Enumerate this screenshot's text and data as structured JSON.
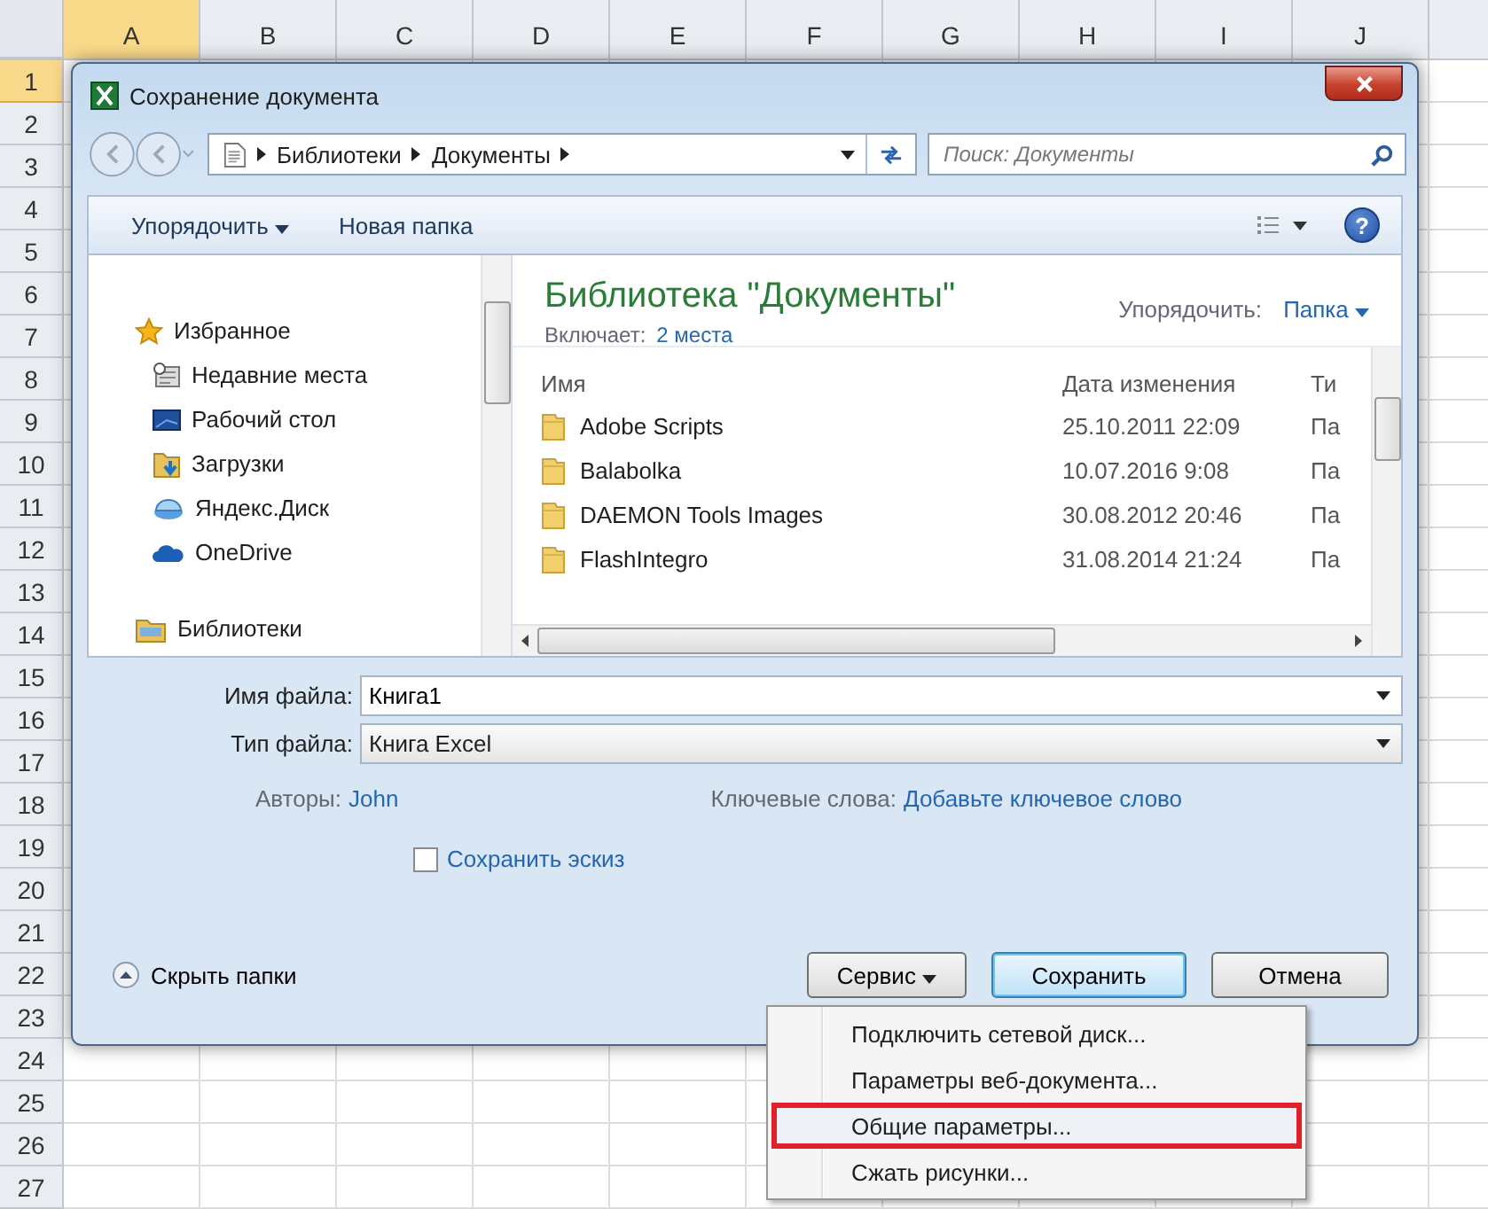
{
  "spreadsheet": {
    "columns": [
      {
        "label": "A",
        "selected": true
      },
      {
        "label": "B",
        "selected": false
      },
      {
        "label": "C",
        "selected": false
      },
      {
        "label": "D",
        "selected": false
      },
      {
        "label": "E",
        "selected": false
      },
      {
        "label": "F",
        "selected": false
      },
      {
        "label": "G",
        "selected": false
      },
      {
        "label": "H",
        "selected": false
      },
      {
        "label": "I",
        "selected": false
      },
      {
        "label": "J",
        "selected": false
      }
    ],
    "rows": [
      {
        "label": "1",
        "selected": true
      },
      {
        "label": "2",
        "selected": false
      },
      {
        "label": "3",
        "selected": false
      },
      {
        "label": "4",
        "selected": false
      },
      {
        "label": "5",
        "selected": false
      },
      {
        "label": "6",
        "selected": false
      },
      {
        "label": "7",
        "selected": false
      },
      {
        "label": "8",
        "selected": false
      },
      {
        "label": "9",
        "selected": false
      },
      {
        "label": "10",
        "selected": false
      },
      {
        "label": "11",
        "selected": false
      },
      {
        "label": "12",
        "selected": false
      },
      {
        "label": "13",
        "selected": false
      },
      {
        "label": "14",
        "selected": false
      },
      {
        "label": "15",
        "selected": false
      },
      {
        "label": "16",
        "selected": false
      },
      {
        "label": "17",
        "selected": false
      },
      {
        "label": "18",
        "selected": false
      },
      {
        "label": "19",
        "selected": false
      },
      {
        "label": "20",
        "selected": false
      },
      {
        "label": "21",
        "selected": false
      },
      {
        "label": "22",
        "selected": false
      },
      {
        "label": "23",
        "selected": false
      },
      {
        "label": "24",
        "selected": false
      },
      {
        "label": "25",
        "selected": false
      },
      {
        "label": "26",
        "selected": false
      },
      {
        "label": "27",
        "selected": false
      }
    ]
  },
  "dialog": {
    "title": "Сохранение документа",
    "breadcrumb": [
      "Библиотеки",
      "Документы"
    ],
    "search": {
      "placeholder": "Поиск: Документы"
    },
    "organize_button": "Упорядочить",
    "new_folder_button": "Новая папка",
    "help_button": "?",
    "nav": [
      {
        "label": "Избранное",
        "kind": "favorites",
        "children": [
          {
            "label": "Недавние места",
            "kind": "recent"
          },
          {
            "label": "Рабочий стол",
            "kind": "desktop"
          },
          {
            "label": "Загрузки",
            "kind": "downloads"
          },
          {
            "label": "Яндекс.Диск",
            "kind": "yadisk"
          },
          {
            "label": "OneDrive",
            "kind": "onedrive"
          }
        ]
      },
      {
        "label": "Библиотеки",
        "kind": "libraries"
      }
    ],
    "library": {
      "title": "Библиотека \"Документы\"",
      "includes_label": "Включает:",
      "includes_link": "2 места",
      "arrange_label": "Упорядочить:",
      "arrange_value": "Папка"
    },
    "columns": [
      "Имя",
      "Дата изменения",
      "Ти"
    ],
    "files": [
      {
        "name": "Adobe Scripts",
        "date": "25.10.2011 22:09",
        "type": "Па"
      },
      {
        "name": "Balabolka",
        "date": "10.07.2016 9:08",
        "type": "Па"
      },
      {
        "name": "DAEMON Tools Images",
        "date": "30.08.2012 20:46",
        "type": "Па"
      },
      {
        "name": "FlashIntegro",
        "date": "31.08.2014 21:24",
        "type": "Па"
      }
    ],
    "form": {
      "file_name_label": "Имя файла:",
      "file_name": "Книга1",
      "file_type_label": "Тип файла:",
      "file_type": "Книга Excel",
      "authors_label": "Авторы:",
      "authors": "John",
      "keywords_label": "Ключевые слова:",
      "keywords": "Добавьте ключевое слово",
      "thumbnail": {
        "label": "Сохранить эскиз",
        "checked": false
      }
    },
    "hide_folders": "Скрыть папки",
    "tools_button": "Сервис",
    "save_button": "Сохранить",
    "cancel_button": "Отмена",
    "tools_menu": [
      {
        "label": "Подключить сетевой диск...",
        "selected": false
      },
      {
        "label": "Параметры веб-документа...",
        "selected": false
      },
      {
        "label": "Общие параметры...",
        "selected": true
      },
      {
        "label": "Сжать рисунки...",
        "selected": false
      }
    ]
  }
}
